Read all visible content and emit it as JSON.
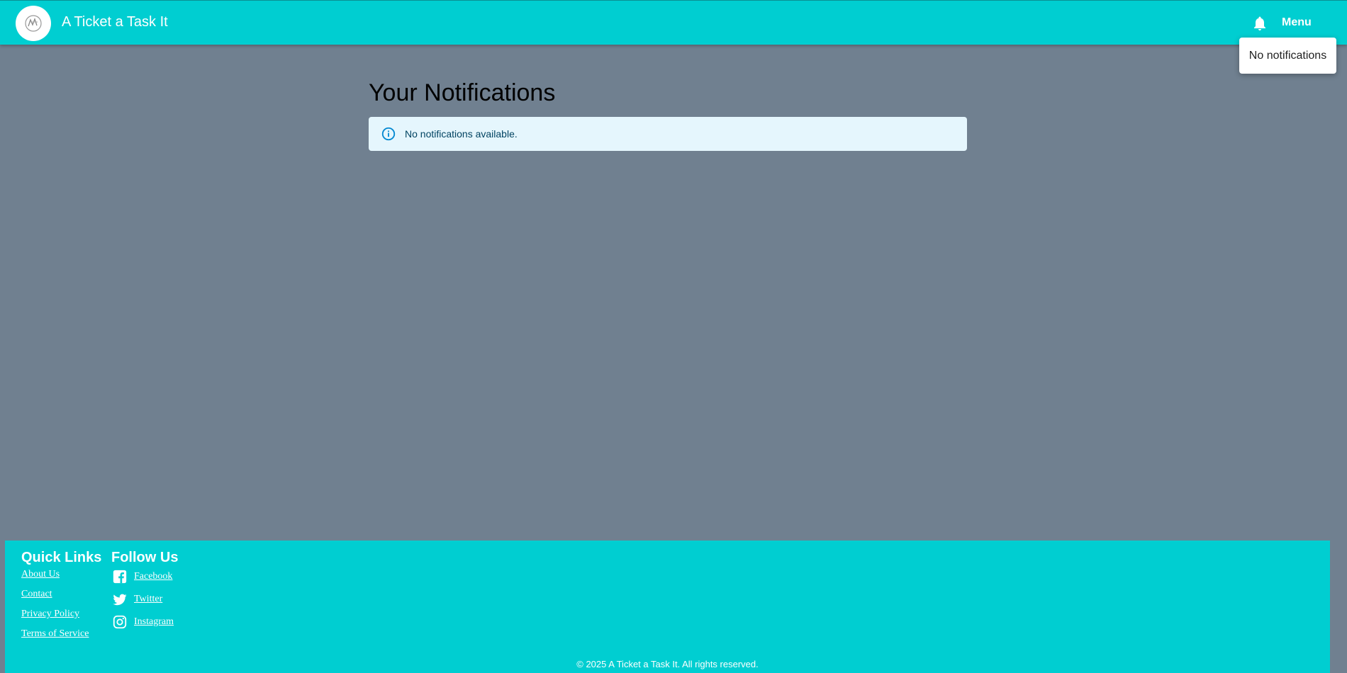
{
  "header": {
    "brand": "A Ticket a Task It",
    "menu_label": "Menu",
    "notifications_dropdown": "No notifications"
  },
  "main": {
    "title": "Your Notifications",
    "alert_text": "No notifications available."
  },
  "footer": {
    "quick_links_title": "Quick Links",
    "quick_links": [
      "About Us",
      "Contact",
      "Privacy Policy",
      "Terms of Service"
    ],
    "follow_title": "Follow Us",
    "social": [
      {
        "label": "Facebook",
        "icon": "facebook-icon"
      },
      {
        "label": "Twitter",
        "icon": "twitter-icon"
      },
      {
        "label": "Instagram",
        "icon": "instagram-icon"
      }
    ],
    "copyright": "© 2025 A Ticket a Task It. All rights reserved."
  },
  "colors": {
    "header_bg": "#00CED1",
    "page_bg": "#708090",
    "alert_bg": "#e5f6fd",
    "alert_icon": "#0288d1"
  }
}
